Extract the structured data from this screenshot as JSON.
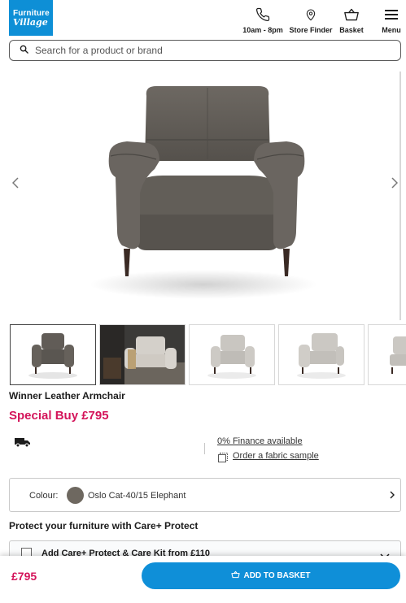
{
  "header": {
    "logo_line1": "Furniture",
    "logo_line2": "Village",
    "nav": {
      "hours": "10am - 8pm",
      "store_finder": "Store Finder",
      "basket": "Basket",
      "menu": "Menu"
    },
    "icons": [
      "phone-icon",
      "location-pin-icon",
      "basket-icon",
      "hamburger-menu-icon"
    ]
  },
  "search": {
    "placeholder": "Search for a product or brand"
  },
  "gallery": {
    "thumbnail_count": 5,
    "selected_index": 0
  },
  "product": {
    "name": "Winner Leather Armchair",
    "price_label": "Special Buy £795",
    "finance_link": "0% Finance available",
    "sample_link": "Order a fabric sample"
  },
  "colour": {
    "label": "Colour:",
    "value": "Oslo Cat-40/15 Elephant",
    "swatch_color": "#6e6860"
  },
  "care": {
    "title": "Protect your furniture with Care+ Protect",
    "option_text": "Add Care+ Protect & Care Kit from £110"
  },
  "bottom_bar": {
    "price": "£795",
    "add_to_basket": "ADD TO BASKET"
  },
  "colors": {
    "brand_blue": "#0f8fd8",
    "price_pink": "#d4145a"
  }
}
